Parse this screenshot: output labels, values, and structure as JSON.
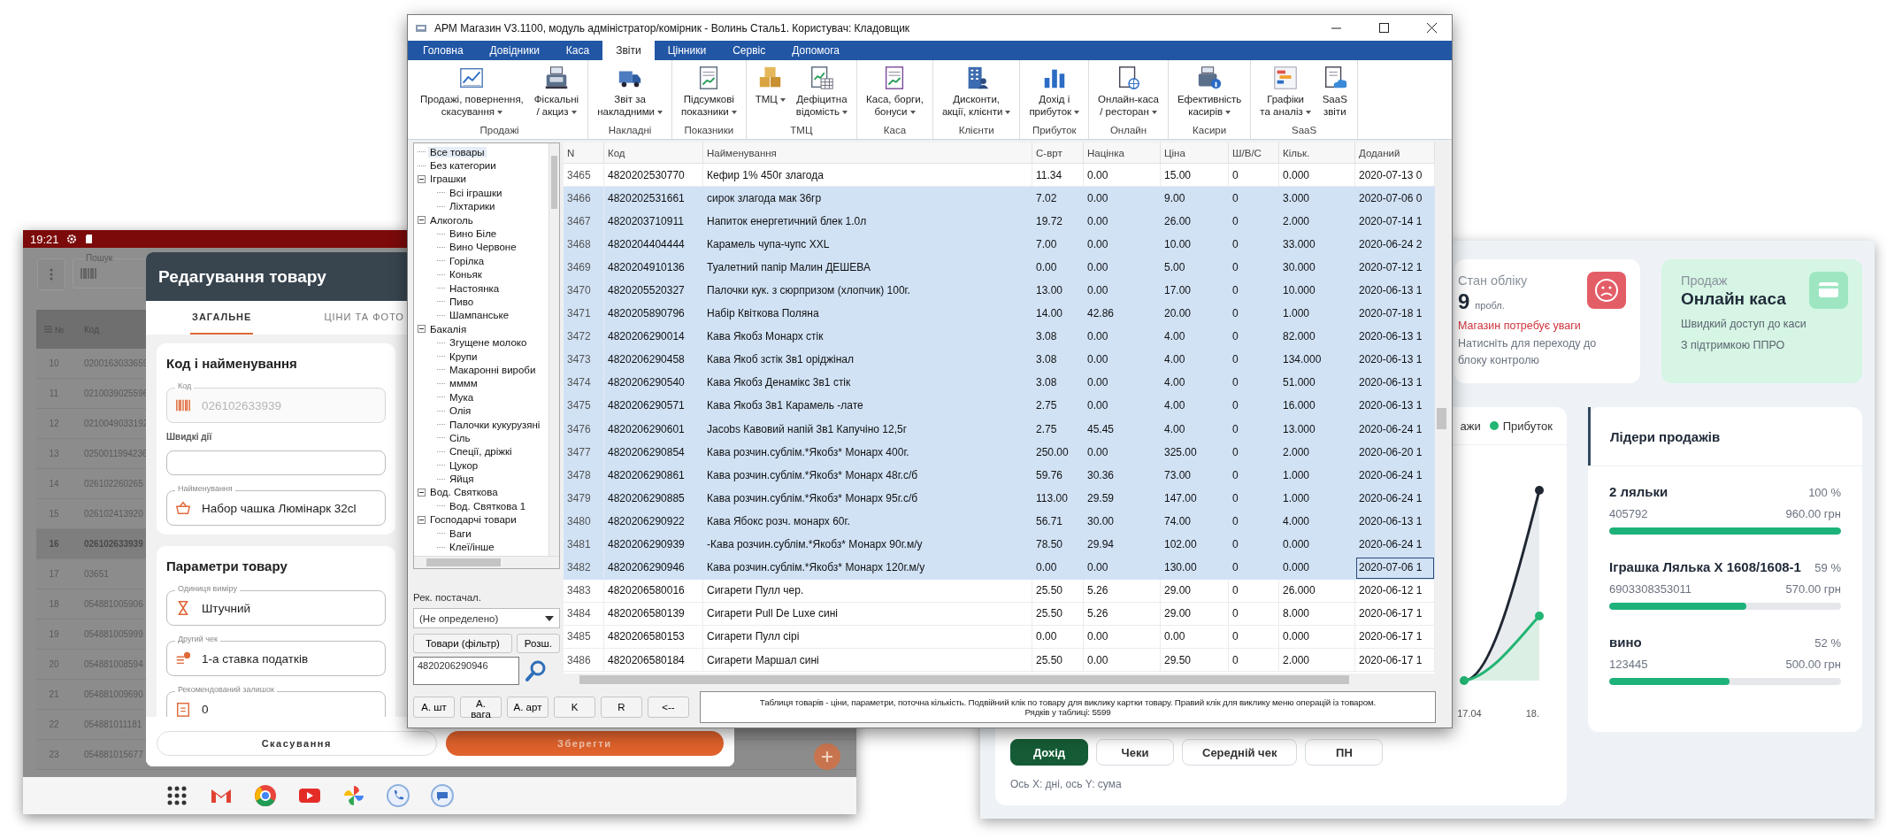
{
  "tablet": {
    "status_bar": {
      "time": "19:21"
    },
    "search": {
      "label": "Пошук"
    },
    "list": {
      "columns": [
        "№",
        "Код"
      ],
      "rows": [
        {
          "n": "10",
          "code": "0200163033659",
          "selected": false
        },
        {
          "n": "11",
          "code": "0210039025596",
          "selected": false
        },
        {
          "n": "12",
          "code": "0210049033192",
          "selected": false
        },
        {
          "n": "13",
          "code": "0250011994236",
          "selected": false
        },
        {
          "n": "14",
          "code": "026102260265",
          "selected": false
        },
        {
          "n": "15",
          "code": "026102413920",
          "selected": false
        },
        {
          "n": "16",
          "code": "026102633939",
          "selected": true
        },
        {
          "n": "17",
          "code": "03651",
          "selected": false
        },
        {
          "n": "18",
          "code": "054881005906",
          "selected": false
        },
        {
          "n": "19",
          "code": "054881005999",
          "selected": false
        },
        {
          "n": "20",
          "code": "054881008594",
          "selected": false
        },
        {
          "n": "21",
          "code": "054881009690",
          "selected": false
        },
        {
          "n": "22",
          "code": "054881011181",
          "selected": false
        },
        {
          "n": "23",
          "code": "054881015677",
          "selected": false
        }
      ]
    },
    "dialog": {
      "title": "Редагування товару",
      "tabs": [
        {
          "label": "ЗАГАЛЬНЕ",
          "selected": true
        },
        {
          "label": "ЦІНИ ТА ФОТО",
          "selected": false
        }
      ],
      "sections": [
        {
          "title": "Код і найменування",
          "fields": [
            {
              "kind": "field",
              "label": "Код",
              "value": "026102633939",
              "disabled": true
            },
            {
              "kind": "caption",
              "label": "Швидкі дії"
            },
            {
              "kind": "blank_field"
            },
            {
              "kind": "field",
              "label": "Найменування",
              "value": "Набор чашка Люмінарк 32cl",
              "disabled": false
            }
          ]
        },
        {
          "title": "Параметри товару",
          "fields": [
            {
              "kind": "field",
              "label": "Одиниця виміру",
              "value": "Штучний",
              "disabled": false
            },
            {
              "kind": "field",
              "label": "Другий чек",
              "value": "1-а ставка податків",
              "disabled": false
            },
            {
              "kind": "field",
              "label": "Рекомендований залишок",
              "value": "0",
              "disabled": false
            }
          ]
        }
      ],
      "buttons": [
        {
          "label": "Скасування",
          "kind": "secondary"
        },
        {
          "label": "Зберегти",
          "kind": "primary"
        }
      ]
    }
  },
  "main_window": {
    "title": "АРМ Магазин V3.1100, модуль адміністратор/комірник - Волинь Сталь1. Користувач: Кладовщик",
    "menu": [
      {
        "label": "Головна",
        "selected": false
      },
      {
        "label": "Довідники",
        "selected": false
      },
      {
        "label": "Каса",
        "selected": false
      },
      {
        "label": "Звіти",
        "selected": true
      },
      {
        "label": "Цінники",
        "selected": false
      },
      {
        "label": "Сервіс",
        "selected": false
      },
      {
        "label": "Допомога",
        "selected": false
      }
    ],
    "ribbon": [
      {
        "label": "Продажі",
        "buttons": [
          {
            "label": "Продажі, повернення,\nскасування",
            "dropdown": true
          },
          {
            "label": "Фіскальні\n/ акциз",
            "dropdown": true
          }
        ]
      },
      {
        "label": "Накладні",
        "buttons": [
          {
            "label": "Звіт за\nнакладними",
            "dropdown": true
          }
        ]
      },
      {
        "label": "Показники",
        "buttons": [
          {
            "label": "Підсумкові\nпоказники",
            "dropdown": true
          }
        ]
      },
      {
        "label": "ТМЦ",
        "buttons": [
          {
            "label": "ТМЦ",
            "dropdown": true
          },
          {
            "label": "Дефіцитна\nвідомість",
            "dropdown": true
          }
        ]
      },
      {
        "label": "Каса",
        "buttons": [
          {
            "label": "Каса, борги,\nбонуси",
            "dropdown": true
          }
        ]
      },
      {
        "label": "Клієнти",
        "buttons": [
          {
            "label": "Дисконти,\nакції, клієнти",
            "dropdown": true
          }
        ]
      },
      {
        "label": "Прибуток",
        "buttons": [
          {
            "label": "Дохід і\nприбуток",
            "dropdown": true
          }
        ]
      },
      {
        "label": "Онлайн",
        "buttons": [
          {
            "label": "Онлайн-каса\n/ ресторан",
            "dropdown": true
          }
        ]
      },
      {
        "label": "Касири",
        "buttons": [
          {
            "label": "Ефективність\nкасирів",
            "dropdown": true
          }
        ]
      },
      {
        "label": "SaaS",
        "buttons": [
          {
            "label": "Графіки\nта аналіз",
            "dropdown": true
          },
          {
            "label": "SaaS\nзвіти",
            "dropdown": false
          }
        ]
      }
    ],
    "tree": [
      {
        "label": "Все товары",
        "selected": true
      },
      {
        "label": "Без категории",
        "selected": false
      },
      {
        "label": "Іграшки",
        "selected": false,
        "expanded": true,
        "children": [
          {
            "label": "Всі іграшки",
            "selected": false
          },
          {
            "label": "Ліхтарики",
            "selected": false
          }
        ]
      },
      {
        "label": "Алкоголь",
        "selected": false,
        "expanded": true,
        "children": [
          {
            "label": "Вино Біле",
            "selected": false
          },
          {
            "label": "Вино Червоне",
            "selected": false
          },
          {
            "label": "Горілка",
            "selected": false
          },
          {
            "label": "Коньяк",
            "selected": false
          },
          {
            "label": "Настоянка",
            "selected": false
          },
          {
            "label": "Пиво",
            "selected": false
          },
          {
            "label": "Шампанське",
            "selected": false
          }
        ]
      },
      {
        "label": "Бакалія",
        "selected": false,
        "expanded": true,
        "children": [
          {
            "label": "Згущене молоко",
            "selected": false
          },
          {
            "label": "Крупи",
            "selected": false
          },
          {
            "label": "Макаронні вироби",
            "selected": false
          },
          {
            "label": "мммм",
            "selected": false
          },
          {
            "label": "Мука",
            "selected": false
          },
          {
            "label": "Олія",
            "selected": false
          },
          {
            "label": "Палочки кукурузяні",
            "selected": false
          },
          {
            "label": "Сіль",
            "selected": false
          },
          {
            "label": "Спеції, дріжкі",
            "selected": false
          },
          {
            "label": "Цукор",
            "selected": false
          },
          {
            "label": "Яйця",
            "selected": false
          }
        ]
      },
      {
        "label": "Вод. Святкова",
        "selected": false,
        "expanded": true,
        "children": [
          {
            "label": "Вод. Святкова 1",
            "selected": false
          }
        ]
      },
      {
        "label": "Господарчі товари",
        "selected": false,
        "expanded": true,
        "children": [
          {
            "label": "Ваги",
            "selected": false
          },
          {
            "label": "Клеї/інше",
            "selected": false
          }
        ]
      }
    ],
    "supplier": {
      "label": "Рек. постачал.",
      "value": "(Не определено)"
    },
    "filter_buttons": [
      "Товари (фільтр)",
      "Розш."
    ],
    "search": {
      "value": "4820206290946"
    },
    "bottom_buttons": [
      "А. шт",
      "А. вага",
      "А. арт",
      "K",
      "R",
      "<--"
    ],
    "table": {
      "columns": [
        "N",
        "Код",
        "Найменування",
        "С-врт",
        "Націнка",
        "Ціна",
        "Ш/В/С",
        "Кільк.",
        "Доданий"
      ],
      "rows": [
        {
          "cells": [
            "3465",
            "4820202530770",
            "Кефир 1% 450г злагода",
            "11.34",
            "0.00",
            "15.00",
            "0",
            "0.000",
            "2020-07-13 0"
          ],
          "selected": false,
          "focused": false
        },
        {
          "cells": [
            "3466",
            "4820202531661",
            "сирок злагода мак 36гр",
            "7.02",
            "0.00",
            "9.00",
            "0",
            "3.000",
            "2020-07-06 0"
          ],
          "selected": true,
          "focused": false
        },
        {
          "cells": [
            "3467",
            "4820203710911",
            "Напиток енергетичний блек 1.0л",
            "19.72",
            "0.00",
            "26.00",
            "0",
            "2.000",
            "2020-07-14 1"
          ],
          "selected": true,
          "focused": false
        },
        {
          "cells": [
            "3468",
            "4820204404444",
            "Карамель чупа-чупс XXL",
            "7.00",
            "0.00",
            "10.00",
            "0",
            "33.000",
            "2020-06-24 2"
          ],
          "selected": true,
          "focused": false
        },
        {
          "cells": [
            "3469",
            "4820204910136",
            "Туалетний папір Малин ДЕШЕВА",
            "0.00",
            "0.00",
            "5.00",
            "0",
            "30.000",
            "2020-07-12 1"
          ],
          "selected": true,
          "focused": false
        },
        {
          "cells": [
            "3470",
            "4820205520327",
            "Палочки кук. з сюрпризом (хлопчик) 100г.",
            "13.00",
            "0.00",
            "17.00",
            "0",
            "10.000",
            "2020-06-13 1"
          ],
          "selected": true,
          "focused": false
        },
        {
          "cells": [
            "3471",
            "4820205890796",
            "Набір Квіткова Поляна",
            "14.00",
            "42.86",
            "20.00",
            "0",
            "1.000",
            "2020-07-18 1"
          ],
          "selected": true,
          "focused": false
        },
        {
          "cells": [
            "3472",
            "4820206290014",
            "Кава Якобз Монарх стік",
            "3.08",
            "0.00",
            "4.00",
            "0",
            "82.000",
            "2020-06-13 1"
          ],
          "selected": true,
          "focused": false
        },
        {
          "cells": [
            "3473",
            "4820206290458",
            "Кава Якоб зстік 3в1 оріджінал",
            "3.08",
            "0.00",
            "4.00",
            "0",
            "134.000",
            "2020-06-13 1"
          ],
          "selected": true,
          "focused": false
        },
        {
          "cells": [
            "3474",
            "4820206290540",
            "Кава Якобз Денамікс 3в1 стік",
            "3.08",
            "0.00",
            "4.00",
            "0",
            "51.000",
            "2020-06-13 1"
          ],
          "selected": true,
          "focused": false
        },
        {
          "cells": [
            "3475",
            "4820206290571",
            "Кава Якобз 3в1 Карамель -лате",
            "2.75",
            "0.00",
            "4.00",
            "0",
            "16.000",
            "2020-06-13 1"
          ],
          "selected": true,
          "focused": false
        },
        {
          "cells": [
            "3476",
            "4820206290601",
            "Jacobs Кавовий напій 3в1  Капучіно 12,5г",
            "2.75",
            "45.45",
            "4.00",
            "0",
            "13.000",
            "2020-06-24 1"
          ],
          "selected": true,
          "focused": false
        },
        {
          "cells": [
            "3477",
            "4820206290854",
            "Кава розчин.сублім.*Якобз* Монарх 400г.",
            "250.00",
            "0.00",
            "325.00",
            "0",
            "2.000",
            "2020-06-20 1"
          ],
          "selected": true,
          "focused": false
        },
        {
          "cells": [
            "3478",
            "4820206290861",
            "Кава розчин.сублім.*Якобз* Монарх 48г.с/б",
            "59.76",
            "30.36",
            "73.00",
            "0",
            "1.000",
            "2020-06-24 1"
          ],
          "selected": true,
          "focused": false
        },
        {
          "cells": [
            "3479",
            "4820206290885",
            "Кава розчин.сублім.*Якобз* Монарх 95г.с/б",
            "113.00",
            "29.59",
            "147.00",
            "0",
            "1.000",
            "2020-06-24 1"
          ],
          "selected": true,
          "focused": false
        },
        {
          "cells": [
            "3480",
            "4820206290922",
            "Кава  Ябокс розч. монарх 60г.",
            "56.71",
            "30.00",
            "74.00",
            "0",
            "4.000",
            "2020-06-13 1"
          ],
          "selected": true,
          "focused": false
        },
        {
          "cells": [
            "3481",
            "4820206290939",
            "-Кава розчин.сублім.*Якобз* Монарх 90г.м/у",
            "78.50",
            "29.94",
            "102.00",
            "0",
            "0.000",
            "2020-06-24 1"
          ],
          "selected": true,
          "focused": false
        },
        {
          "cells": [
            "3482",
            "4820206290946",
            "Кава розчин.сублім.*Якобз* Монарх 120г.м/у",
            "0.00",
            "0.00",
            "130.00",
            "0",
            "0.000",
            "2020-07-06 1"
          ],
          "selected": true,
          "focused": true
        },
        {
          "cells": [
            "3483",
            "4820206580016",
            "Сигарети Пулл чер.",
            "25.50",
            "5.26",
            "29.00",
            "0",
            "26.000",
            "2020-06-12 1"
          ],
          "selected": false,
          "focused": false
        },
        {
          "cells": [
            "3484",
            "4820206580139",
            "Сигарети Pull De Luxe сині",
            "25.50",
            "5.26",
            "29.00",
            "0",
            "8.000",
            "2020-06-17 1"
          ],
          "selected": false,
          "focused": false
        },
        {
          "cells": [
            "3485",
            "4820206580153",
            "Сигарети Пулл сірі",
            "0.00",
            "0.00",
            "0.00",
            "0",
            "0.000",
            "2020-06-17 1"
          ],
          "selected": false,
          "focused": false
        },
        {
          "cells": [
            "3486",
            "4820206580184",
            "Сигарети Маршал сині",
            "25.50",
            "0.00",
            "29.50",
            "0",
            "2.000",
            "2020-06-17 1"
          ],
          "selected": false,
          "focused": false
        }
      ]
    },
    "status": [
      "Таблиця товарів - ціни, параметри, поточна кількість. Подвійний клік по товару для виклику картки товару. Правий клік для виклику меню операцій із товаром.",
      "Рядків у таблиці: 5599"
    ]
  },
  "dashboard": {
    "status_card": {
      "title": "Стан обліку",
      "count": "9",
      "unit": "пробл.",
      "alert": "Магазин потребує уваги",
      "hint": "Натисніть для переходу до\nблоку контролю"
    },
    "sales_card": {
      "title": "Продаж",
      "heading": "Онлайн каса",
      "lines": [
        "Швидкий доступ до каси",
        "З підтримкою ППРО"
      ]
    },
    "chart": {
      "legend": [
        {
          "label": "ажи"
        },
        {
          "label": "Прибуток",
          "color": "#22b573"
        }
      ],
      "x_labels": [
        "17.04",
        "18."
      ],
      "buttons": [
        {
          "label": "Дохід",
          "selected": true
        },
        {
          "label": "Чеки",
          "selected": false
        },
        {
          "label": "Середній чек",
          "selected": false
        },
        {
          "label": "ПН",
          "selected": false
        }
      ],
      "note": "Ось X: дні, ось Y: сума"
    },
    "leaders": {
      "title": "Лідери продажів",
      "items": [
        {
          "name": "2 ляльки",
          "percent": "100 %",
          "code": "405792",
          "amount": "960.00 грн",
          "level": 1.0
        },
        {
          "name": "Іграшка Лялька Х 1608/1608-1",
          "percent": "59 %",
          "code": "6903308353011",
          "amount": "570.00 грн",
          "level": 0.59
        },
        {
          "name": "вино",
          "percent": "52 %",
          "code": "123445",
          "amount": "500.00 грн",
          "level": 0.52
        }
      ]
    }
  }
}
